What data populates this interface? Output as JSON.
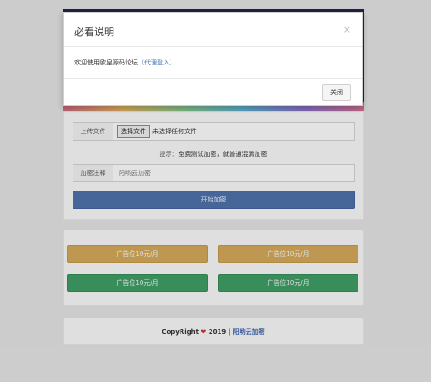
{
  "modal": {
    "title": "必看说明",
    "close_icon": "×",
    "body_text": "欢迎使用欧皇源码论坛",
    "body_link_open": "（",
    "body_link": "代理登入",
    "body_link_close": "）",
    "button_label": "关闭"
  },
  "upload": {
    "file_label": "上传文件",
    "file_button": "选择文件",
    "file_status": "未选择任何文件",
    "tip_prefix": "提示：",
    "tip_text": "免费测试加密，就普通混淆加密",
    "note_label": "加密注释",
    "note_placeholder": "阳哟云加密",
    "start_button": "开始加密"
  },
  "ads": [
    {
      "label": "广告位10元/月",
      "color": "#cfa558"
    },
    {
      "label": "广告位10元/月",
      "color": "#cfa558"
    },
    {
      "label": "广告位10元/月",
      "color": "#3d9a62"
    },
    {
      "label": "广告位10元/月",
      "color": "#3d9a62"
    }
  ],
  "footer": {
    "prefix": "CopyRight",
    "heart": "❤",
    "year": "2019 |",
    "link": "阳哟云加密"
  },
  "colors": {
    "start_button": "#4d6fa8",
    "ad_yellow": "#cfa558",
    "ad_green": "#3d9a62",
    "link_blue": "#3f64a8"
  }
}
